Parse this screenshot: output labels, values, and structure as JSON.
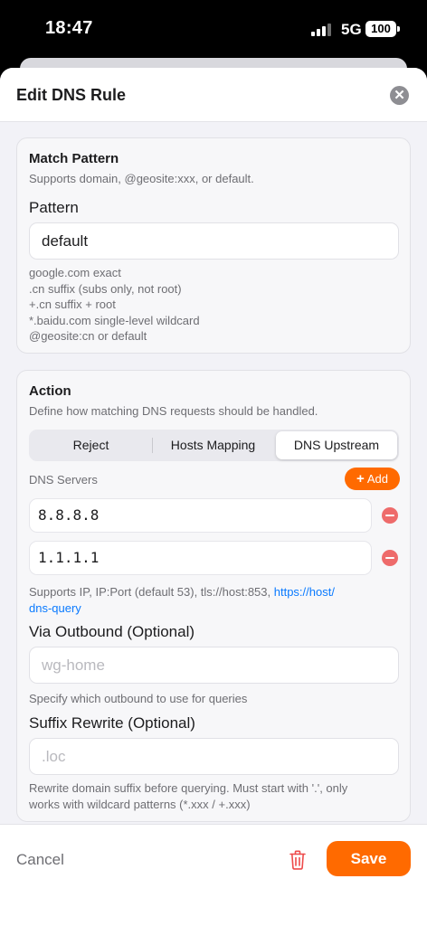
{
  "status_bar": {
    "time": "18:47",
    "network": "5G",
    "battery": "100"
  },
  "sheet": {
    "title": "Edit DNS Rule"
  },
  "match": {
    "title": "Match Pattern",
    "subtitle": "Supports domain, @geosite:xxx, or default.",
    "pattern_label": "Pattern",
    "pattern_value": "default",
    "hints": [
      "google.com exact",
      ".cn suffix (subs only, not root)",
      "+.cn suffix + root",
      "*.baidu.com single-level wildcard",
      "@geosite:cn or default"
    ]
  },
  "action": {
    "title": "Action",
    "subtitle": "Define how matching DNS requests should be handled.",
    "segments": [
      {
        "label": "Reject",
        "selected": false
      },
      {
        "label": "Hosts Mapping",
        "selected": false
      },
      {
        "label": "DNS Upstream",
        "selected": true
      }
    ],
    "dns_servers_label": "DNS Servers",
    "add_label": "Add",
    "servers": [
      "8.8.8.8",
      "1.1.1.1"
    ],
    "servers_hint_line1": "Supports IP, IP:Port (default 53), tls://host:853, ",
    "servers_hint_link1": "https://host/",
    "servers_hint_link2": "dns-query",
    "outbound_label": "Via Outbound (Optional)",
    "outbound_placeholder": "wg-home",
    "outbound_hint": "Specify which outbound to use for queries",
    "suffix_label": "Suffix Rewrite (Optional)",
    "suffix_placeholder": ".loc",
    "suffix_hint_line1": "Rewrite domain suffix before querying. Must start with '.', only",
    "suffix_hint_line2": "works with wildcard patterns (*.xxx / +.xxx)"
  },
  "footer": {
    "cancel_label": "Cancel",
    "save_label": "Save"
  },
  "colors": {
    "accent": "#ff6a00",
    "link": "#0a7aff",
    "destructive": "#ee6b6b",
    "background": "#f2f2f7"
  },
  "icons": {
    "close": "close-icon",
    "add": "plus-icon",
    "remove": "minus-circle-icon",
    "delete": "trash-icon"
  }
}
